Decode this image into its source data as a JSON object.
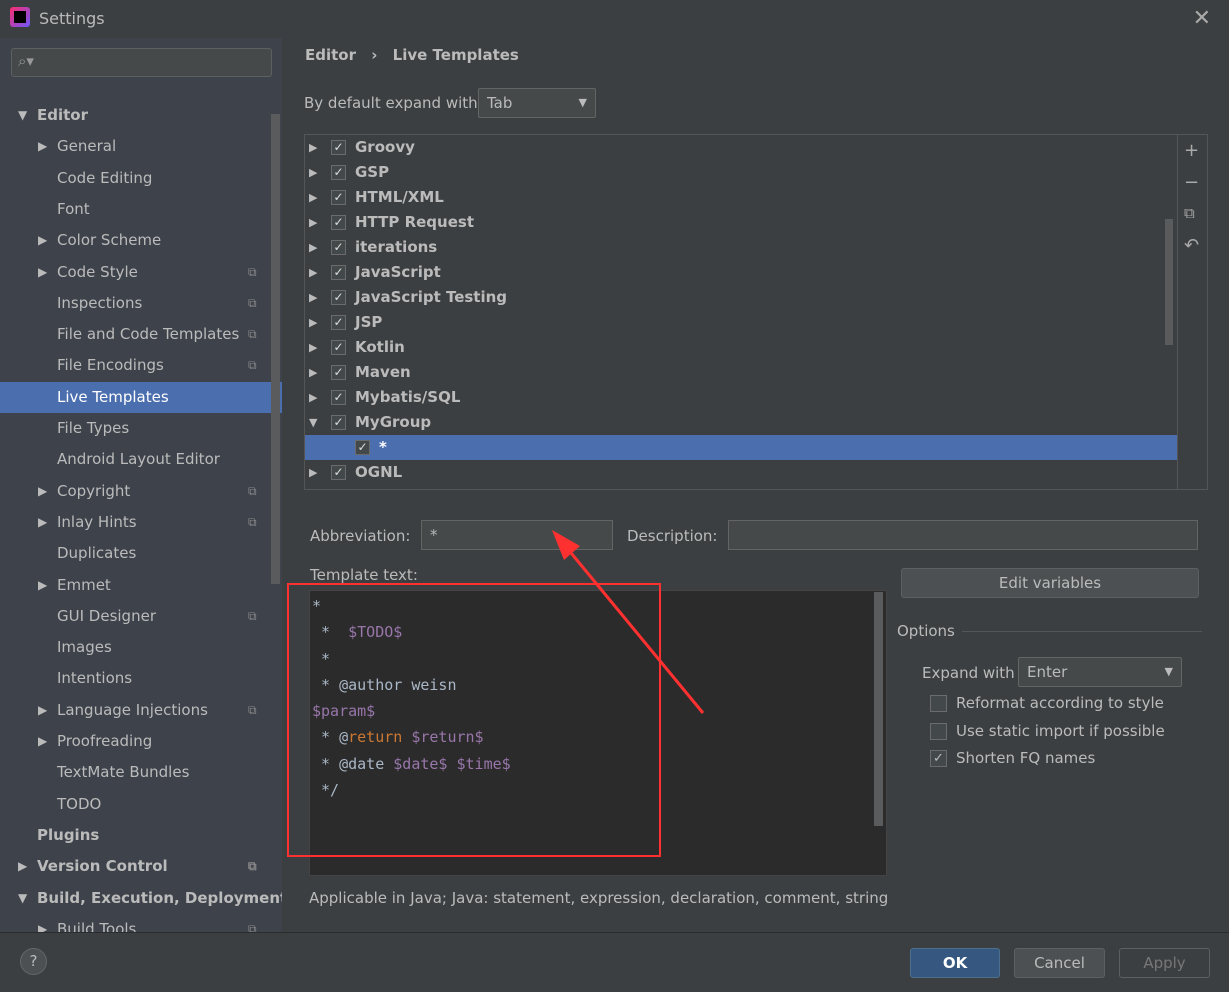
{
  "window": {
    "title": "Settings"
  },
  "sidebar": {
    "items": [
      {
        "label": "Editor",
        "level": 0,
        "arrow": "▼",
        "bold": true
      },
      {
        "label": "General",
        "level": 1,
        "arrow": "▶"
      },
      {
        "label": "Code Editing",
        "level": 1
      },
      {
        "label": "Font",
        "level": 1
      },
      {
        "label": "Color Scheme",
        "level": 1,
        "arrow": "▶"
      },
      {
        "label": "Code Style",
        "level": 1,
        "arrow": "▶",
        "copy": true
      },
      {
        "label": "Inspections",
        "level": 1,
        "copy": true
      },
      {
        "label": "File and Code Templates",
        "level": 1,
        "copy": true
      },
      {
        "label": "File Encodings",
        "level": 1,
        "copy": true
      },
      {
        "label": "Live Templates",
        "level": 1,
        "selected": true
      },
      {
        "label": "File Types",
        "level": 1
      },
      {
        "label": "Android Layout Editor",
        "level": 1
      },
      {
        "label": "Copyright",
        "level": 1,
        "arrow": "▶",
        "copy": true
      },
      {
        "label": "Inlay Hints",
        "level": 1,
        "arrow": "▶",
        "copy": true
      },
      {
        "label": "Duplicates",
        "level": 1
      },
      {
        "label": "Emmet",
        "level": 1,
        "arrow": "▶"
      },
      {
        "label": "GUI Designer",
        "level": 1,
        "copy": true
      },
      {
        "label": "Images",
        "level": 1
      },
      {
        "label": "Intentions",
        "level": 1
      },
      {
        "label": "Language Injections",
        "level": 1,
        "arrow": "▶",
        "copy": true
      },
      {
        "label": "Proofreading",
        "level": 1,
        "arrow": "▶"
      },
      {
        "label": "TextMate Bundles",
        "level": 1
      },
      {
        "label": "TODO",
        "level": 1
      },
      {
        "label": "Plugins",
        "level": 0,
        "bold": true
      },
      {
        "label": "Version Control",
        "level": 0,
        "arrow": "▶",
        "bold": true,
        "copy": true
      },
      {
        "label": "Build, Execution, Deployment",
        "level": 0,
        "arrow": "▼",
        "bold": true
      },
      {
        "label": "Build Tools",
        "level": 1,
        "arrow": "▶",
        "copy": true
      }
    ]
  },
  "breadcrumb": {
    "parent": "Editor",
    "sep": "›",
    "current": "Live Templates"
  },
  "expand_default": {
    "label": "By default expand with",
    "value": "Tab"
  },
  "tree": [
    {
      "label": "Groovy",
      "arrow": "▶"
    },
    {
      "label": "GSP",
      "arrow": "▶"
    },
    {
      "label": "HTML/XML",
      "arrow": "▶"
    },
    {
      "label": "HTTP Request",
      "arrow": "▶"
    },
    {
      "label": "iterations",
      "arrow": "▶"
    },
    {
      "label": "JavaScript",
      "arrow": "▶"
    },
    {
      "label": "JavaScript Testing",
      "arrow": "▶"
    },
    {
      "label": "JSP",
      "arrow": "▶"
    },
    {
      "label": "Kotlin",
      "arrow": "▶"
    },
    {
      "label": "Maven",
      "arrow": "▶"
    },
    {
      "label": "Mybatis/SQL",
      "arrow": "▶"
    },
    {
      "label": "MyGroup",
      "arrow": "▼"
    },
    {
      "label": "*",
      "child": true,
      "selected": true
    },
    {
      "label": "OGNL",
      "arrow": "▶"
    }
  ],
  "abbreviation": {
    "label": "Abbreviation:",
    "value": "*"
  },
  "description": {
    "label": "Description:",
    "value": ""
  },
  "template_text": {
    "label": "Template text:"
  },
  "edit_variables": "Edit variables",
  "options": {
    "title": "Options",
    "expand_with_label": "Expand with",
    "expand_with_value": "Enter",
    "checks": [
      {
        "label": "Reformat according to style",
        "checked": false
      },
      {
        "label": "Use static import if possible",
        "checked": false
      },
      {
        "label": "Shorten FQ names",
        "checked": true
      }
    ]
  },
  "applicable": "Applicable in Java; Java: statement, expression, declaration, comment, string, sm",
  "buttons": {
    "ok": "OK",
    "cancel": "Cancel",
    "apply": "Apply",
    "help": "?"
  },
  "colors": {
    "accent": "#4b6eaf",
    "annotation": "#ff3030",
    "variable": "#9876aa",
    "keyword": "#cc7832"
  }
}
